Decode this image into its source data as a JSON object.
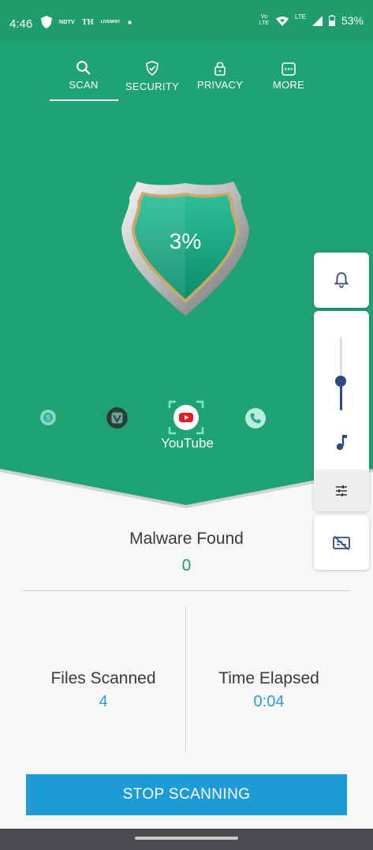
{
  "status_bar": {
    "time": "4:46",
    "notif_ndtv": "NDTV",
    "notif_th": "TH",
    "notif_news": "LIVEMINT",
    "volte": "Vo LTE",
    "lte": "LTE",
    "battery": "53%"
  },
  "tabs": [
    {
      "label": "SCAN",
      "icon": "search-icon",
      "active": true
    },
    {
      "label": "SECURITY",
      "icon": "shield-check-icon",
      "active": false
    },
    {
      "label": "PRIVACY",
      "icon": "lock-icon",
      "active": false
    },
    {
      "label": "MORE",
      "icon": "more-icon",
      "active": false
    }
  ],
  "scan": {
    "progress_text": "3%",
    "progress": 0.03,
    "current_app": "YouTube",
    "apps": [
      "skype-icon",
      "jiosaavn-icon",
      "youtube-icon",
      "phone-icon"
    ]
  },
  "results": {
    "malware_title": "Malware Found",
    "malware_value": "0",
    "files_title": "Files Scanned",
    "files_value": "4",
    "time_title": "Time Elapsed",
    "time_value": "0:04"
  },
  "actions": {
    "stop_label": "STOP SCANNING"
  },
  "volume_panel": {
    "level": 0.4
  },
  "colors": {
    "primary_green": "#1fa274",
    "accent_blue": "#1e9ad6",
    "value_blue": "#2e9bd6",
    "slider_navy": "#2b4a7e"
  }
}
